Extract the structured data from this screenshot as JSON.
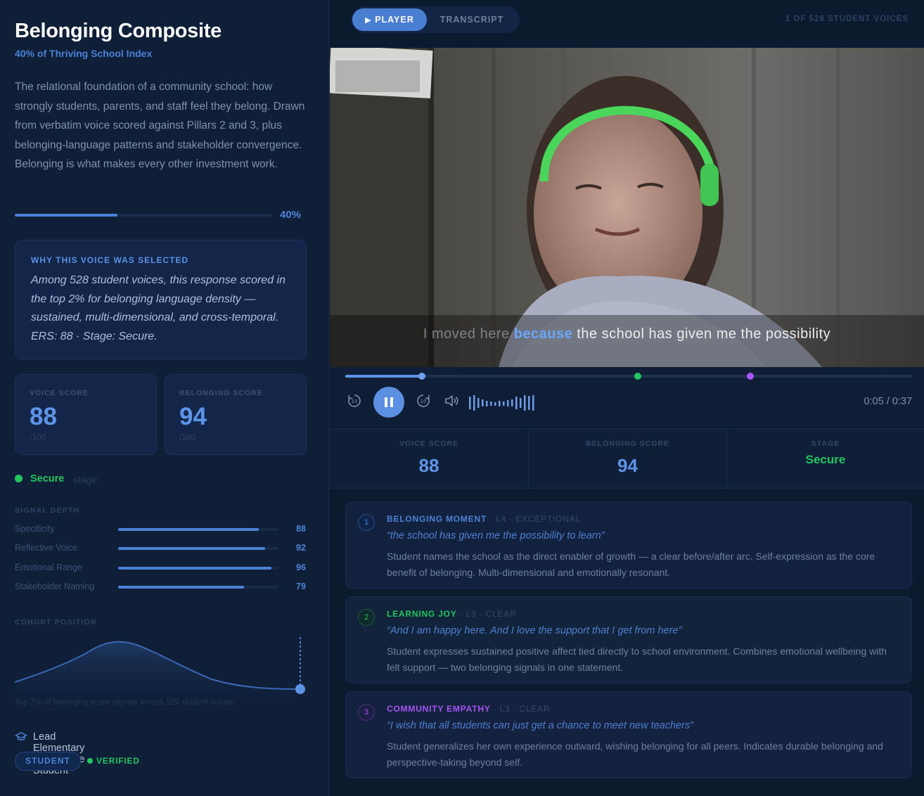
{
  "left": {
    "title": "Belonging Composite",
    "subtitle": "40% of Thriving School Index",
    "description": "The relational foundation of a community school: how strongly students, parents, and staff feel they belong. Drawn from verbatim voice scored against Pillars 2 and 3, plus belonging-language patterns and stakeholder convergence. Belonging is what makes every other investment work.",
    "progress_label": "40%",
    "progress_fraction": 0.4,
    "why": {
      "title": "WHY THIS VOICE WAS SELECTED",
      "text": "Among 528 student voices, this response scored in the top 2% for belonging language density — sustained, multi-dimensional, and cross-temporal. ERS: 88 · Stage: Secure."
    },
    "voice_score": {
      "label": "VOICE SCORE",
      "value": "88",
      "suffix": "/100"
    },
    "belonging_score": {
      "label": "BELONGING SCORE",
      "value": "94",
      "suffix": "/100"
    },
    "stage": {
      "value": "Secure",
      "label": "stage",
      "color": "#22c55e"
    },
    "signal_depth": {
      "title": "SIGNAL DEPTH",
      "items": [
        {
          "name": "Specificity",
          "value": "88",
          "fraction": 0.88
        },
        {
          "name": "Reflective Voice",
          "value": "92",
          "fraction": 0.92
        },
        {
          "name": "Emotional Range",
          "value": "96",
          "fraction": 0.96
        },
        {
          "name": "Stakeholder Naming",
          "value": "79",
          "fraction": 0.79
        }
      ]
    },
    "cohort": {
      "title": "COHORT POSITION",
      "note": "Top 2% of belonging score signals across 528 student voices"
    },
    "school": {
      "icon": "graduation-cap-icon",
      "text": "Lead Elementary · 5th Grade Student"
    },
    "badge": "STUDENT",
    "verified": "VERIFIED"
  },
  "right": {
    "tabs": [
      {
        "label": "PLAYER",
        "icon": "play-icon"
      },
      {
        "label": "TRANSCRIPT"
      }
    ],
    "voices_count": "1 OF 528 STUDENT VOICES",
    "caption": {
      "before": "I moved here ",
      "highlight": "because",
      "after": " the school has given me the possibility"
    },
    "playback_fraction": 0.135,
    "time": "0:05 / 0:37",
    "stats": [
      {
        "label": "VOICE SCORE",
        "value": "88"
      },
      {
        "label": "BELONGING SCORE",
        "value": "94"
      },
      {
        "label": "STAGE",
        "value": "Secure"
      }
    ],
    "moments": [
      {
        "num": "1",
        "color": "#4b82d8",
        "title": "BELONGING MOMENT",
        "level": "· L4 · EXCEPTIONAL",
        "quote": "“the school has given me the possibility to learn”",
        "desc": "Student names the school as the direct enabler of growth — a clear before/after arc. Self-expression as the core benefit of belonging. Multi-dimensional and emotionally resonant."
      },
      {
        "num": "2",
        "color": "#22c55e",
        "title": "LEARNING JOY",
        "level": "· L3 · CLEAR",
        "quote": "“And I am happy here. And I love the support that I get from here”",
        "desc": "Student expresses sustained positive affect tied directly to school environment. Combines emotional wellbeing with felt support — two belonging signals in one statement."
      },
      {
        "num": "3",
        "color": "#a855f7",
        "title": "COMMUNITY EMPATHY",
        "level": "· L3 · CLEAR",
        "quote": "“I wish that all students can just get a chance to meet new teachers”",
        "desc": "Student generalizes her own experience outward, wishing belonging for all peers. Indicates durable belonging and perspective-taking beyond self."
      }
    ]
  }
}
